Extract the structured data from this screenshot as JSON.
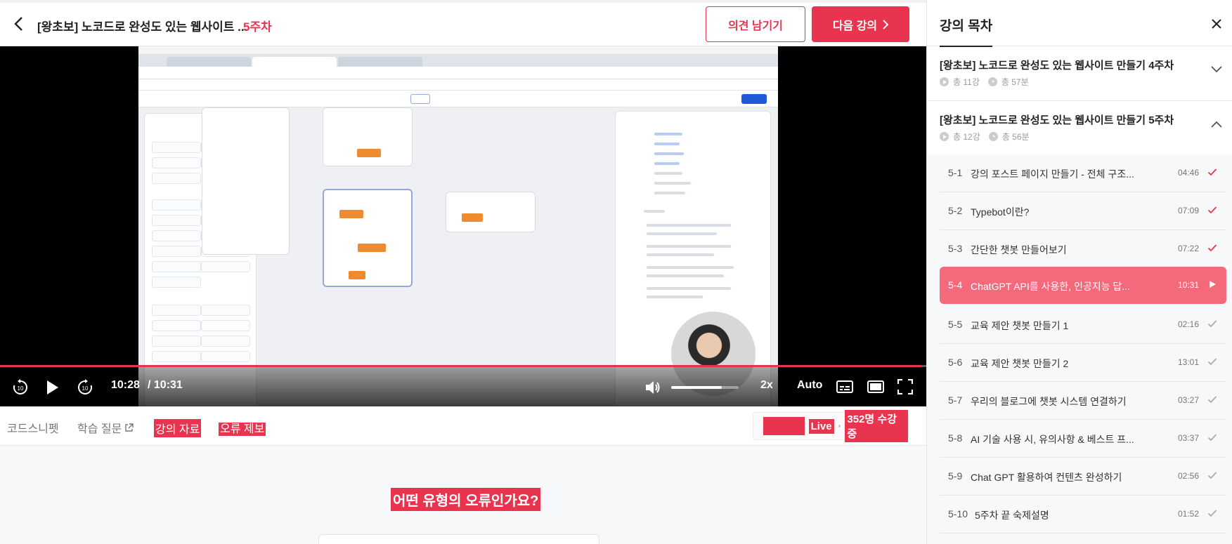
{
  "header": {
    "course_title": "[왕초보] 노코드로 완성도 있는 웹사이트 ...",
    "week": "5주차",
    "feedback_label": "의견 남기기",
    "next_label": "다음 강의"
  },
  "player": {
    "current_time": "10:28",
    "total_time": "/ 10:31",
    "progress_fraction": 0.995,
    "volume_fraction": 0.75,
    "speed": "2x",
    "quality": "Auto"
  },
  "bottom_tabs": {
    "code_snippet": "코드스니펫",
    "qna": "학습 질문",
    "materials": "강의 자료",
    "error_report": "오류 제보"
  },
  "live": {
    "tag": "Live",
    "count": "352명 수강 중"
  },
  "error": {
    "question": "어떤 유형의 오류인가요?"
  },
  "sidebar": {
    "title": "강의 목차",
    "sections": [
      {
        "title": "[왕초보] 노코드로 완성도 있는 웹사이트 만들기 4주차",
        "lessons": "총 11강",
        "duration": "총 57분"
      },
      {
        "title": "[왕초보] 노코드로 완성도 있는 웹사이트 만들기 5주차",
        "lessons": "총 12강",
        "duration": "총 56분"
      }
    ],
    "lessons": [
      {
        "num": "5-1",
        "name": "강의 포스트 페이지 만들기 - 전체 구조...",
        "dur": "04:46",
        "status": "done"
      },
      {
        "num": "5-2",
        "name": "Typebot이란?",
        "dur": "07:09",
        "status": "done"
      },
      {
        "num": "5-3",
        "name": "간단한 챗봇 만들어보기",
        "dur": "07:22",
        "status": "done"
      },
      {
        "num": "5-4",
        "name": "ChatGPT API를 사용한, 인공지능 답...",
        "dur": "10:31",
        "status": "current"
      },
      {
        "num": "5-5",
        "name": "교육 제안 챗봇 만들기 1",
        "dur": "02:16",
        "status": "todo"
      },
      {
        "num": "5-6",
        "name": "교육 제안 챗봇 만들기 2",
        "dur": "13:01",
        "status": "todo"
      },
      {
        "num": "5-7",
        "name": "우리의 블로그에 챗봇 시스템 연결하기",
        "dur": "03:27",
        "status": "todo"
      },
      {
        "num": "5-8",
        "name": "AI 기술 사용 시, 유의사항 & 베스트 프...",
        "dur": "03:37",
        "status": "todo"
      },
      {
        "num": "5-9",
        "name": "Chat GPT 활용하여 컨텐츠 완성하기",
        "dur": "02:56",
        "status": "todo"
      },
      {
        "num": "5-10",
        "name": "5주차 끝 숙제설명",
        "dur": "01:52",
        "status": "todo"
      }
    ]
  },
  "colors": {
    "accent": "#e8344e",
    "current_lesson_bg": "#f46a7c"
  }
}
